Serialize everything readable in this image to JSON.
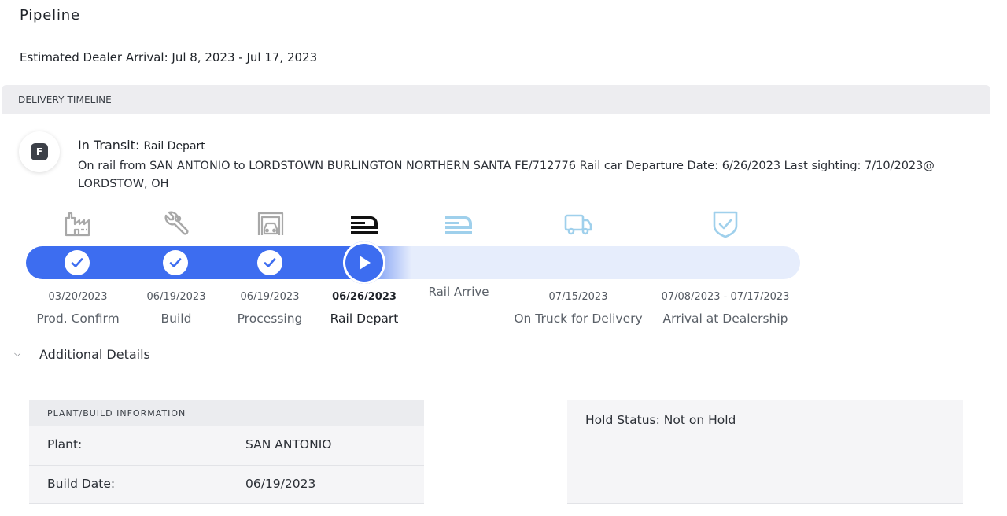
{
  "page": {
    "title": "Pipeline",
    "estimated_arrival": "Estimated Dealer Arrival: Jul 8, 2023 - Jul 17, 2023"
  },
  "timeline": {
    "header": "DELIVERY TIMELINE",
    "status": {
      "badge": "F",
      "title": "In Transit:",
      "subtitle": "Rail Depart",
      "description": "On rail from SAN ANTONIO to LORDSTOWN BURLINGTON NORTHERN SANTA FE/712776 Rail car Departure Date: 6/26/2023 Last sighting: 7/10/2023@ LORDSTOW, OH"
    },
    "steps": [
      {
        "label": "Prod. Confirm",
        "date": "03/20/2023",
        "state": "done",
        "icon": "factory-icon"
      },
      {
        "label": "Build",
        "date": "06/19/2023",
        "state": "done",
        "icon": "wrench-icon"
      },
      {
        "label": "Processing",
        "date": "06/19/2023",
        "state": "done",
        "icon": "garage-car-icon"
      },
      {
        "label": "Rail Depart",
        "date": "06/26/2023",
        "state": "current",
        "icon": "train-icon"
      },
      {
        "label": "Rail Arrive",
        "date": "",
        "state": "future",
        "icon": "train-icon"
      },
      {
        "label": "On Truck for Delivery",
        "date": "07/15/2023",
        "state": "future",
        "icon": "truck-icon"
      },
      {
        "label": "Arrival at Dealership",
        "date": "07/08/2023 - 07/17/2023",
        "state": "future",
        "icon": "shield-check-icon"
      }
    ],
    "colors": {
      "progress": "#3d6df0",
      "track": "#e6edfc",
      "future_icon": "#9fd0ec",
      "done_icon": "#a8a8a8"
    }
  },
  "details": {
    "toggle_label": "Additional Details",
    "plant": {
      "header": "PLANT/BUILD INFORMATION",
      "rows": [
        {
          "key": "Plant:",
          "value": "SAN ANTONIO"
        },
        {
          "key": "Build Date:",
          "value": "06/19/2023"
        }
      ]
    },
    "hold_status": "Hold Status: Not on Hold"
  }
}
